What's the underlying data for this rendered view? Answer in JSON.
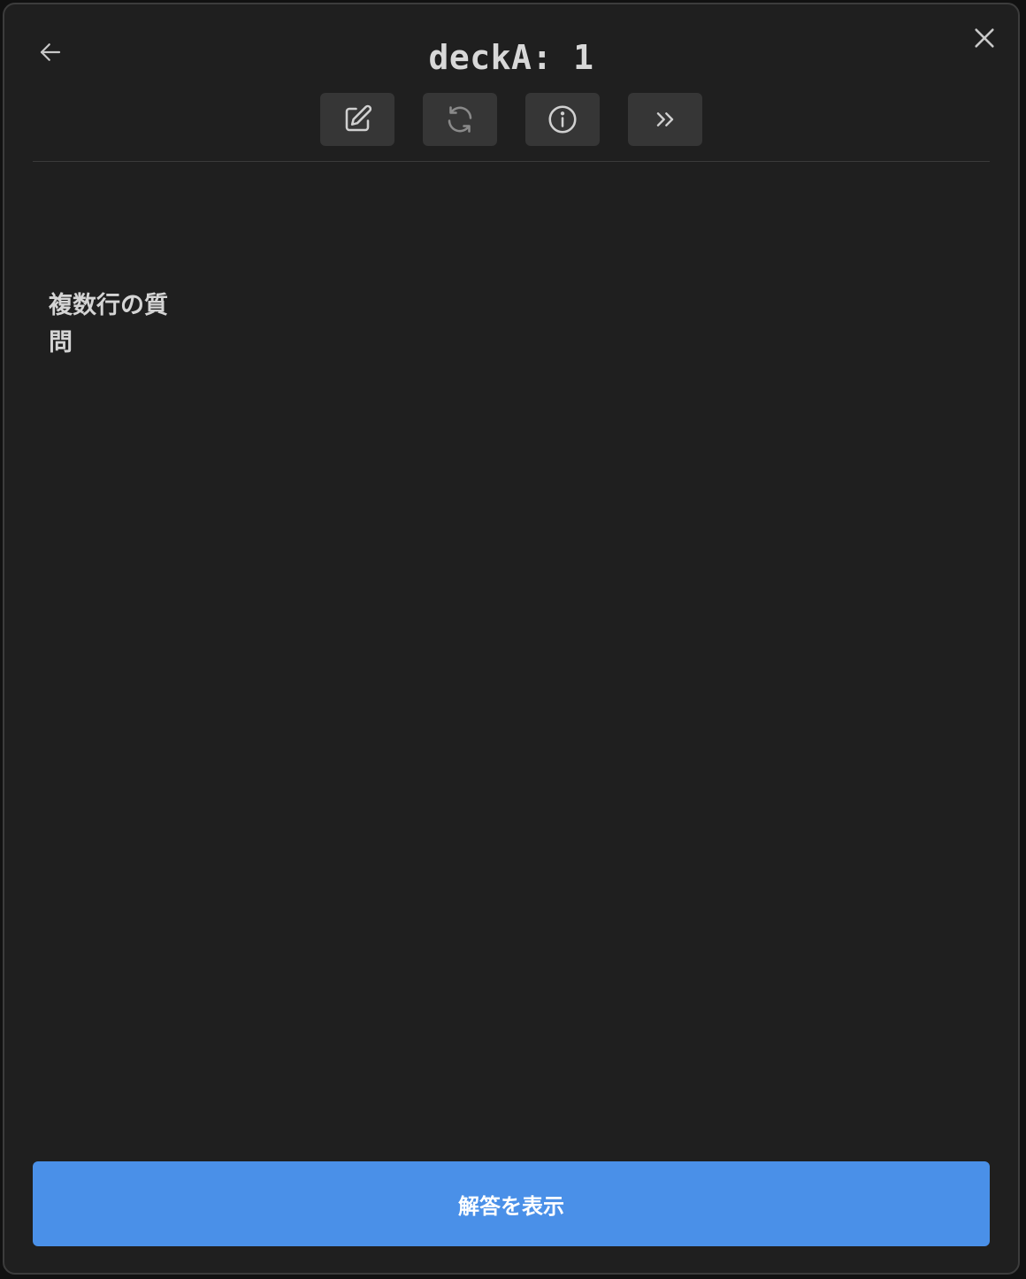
{
  "header": {
    "title": "deckA: 1",
    "back_icon": "arrow-left-icon",
    "close_icon": "close-icon"
  },
  "toolbar": {
    "buttons": [
      {
        "icon": "edit-icon"
      },
      {
        "icon": "refresh-icon"
      },
      {
        "icon": "info-icon"
      },
      {
        "icon": "skip-forward-icon"
      }
    ]
  },
  "card": {
    "question": "複数行の質問"
  },
  "footer": {
    "show_answer_label": "解答を表示"
  },
  "colors": {
    "background": "#1f1f1f",
    "tool_button": "#363636",
    "primary_button": "#4a90e8",
    "text": "#d4d4d4"
  }
}
